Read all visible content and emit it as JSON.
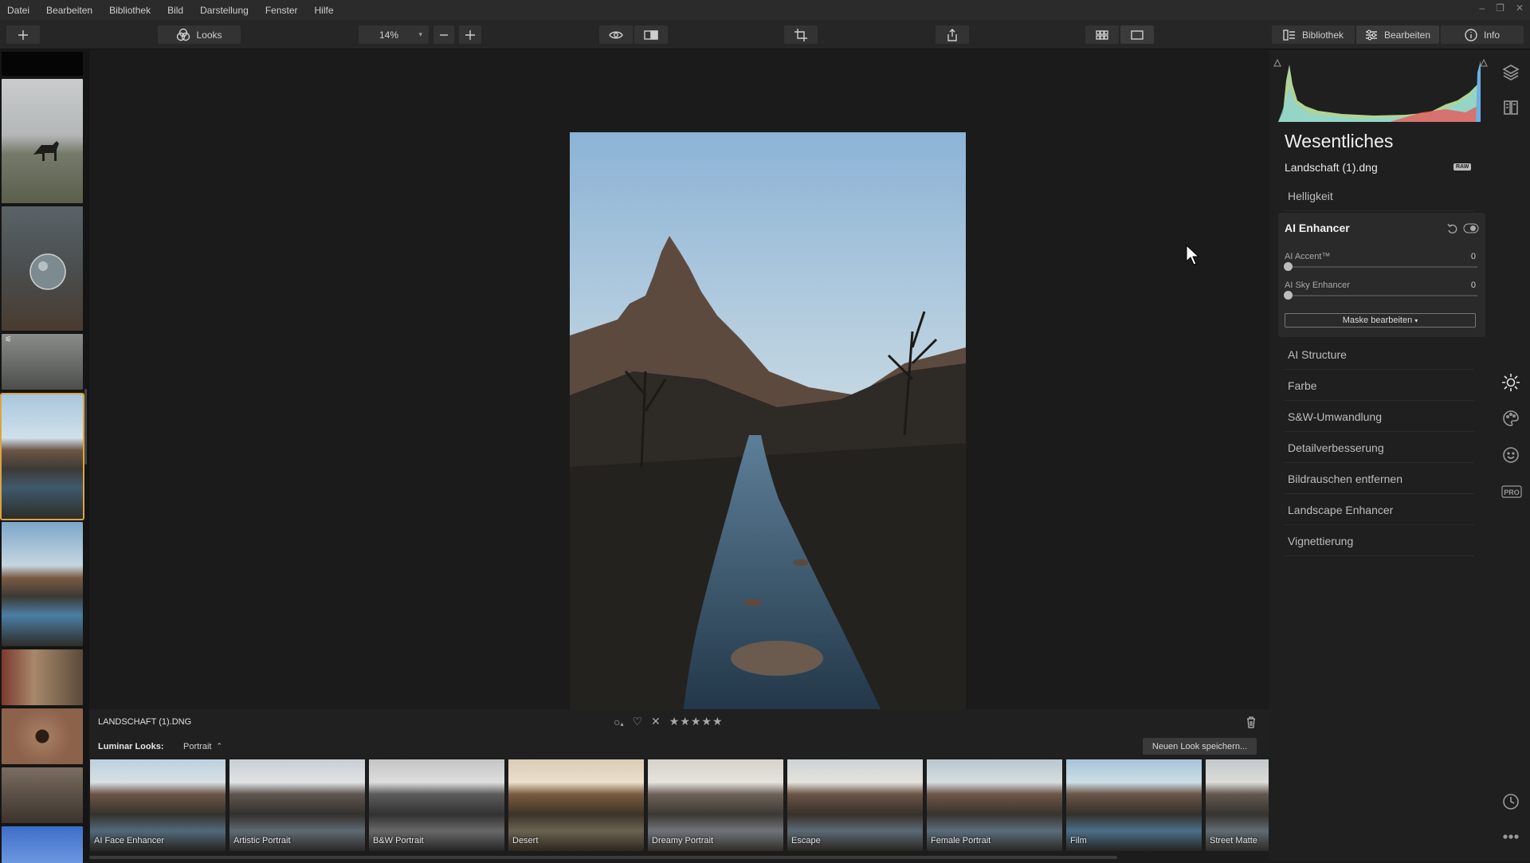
{
  "menu": [
    "Datei",
    "Bearbeiten",
    "Bibliothek",
    "Bild",
    "Darstellung",
    "Fenster",
    "Hilfe"
  ],
  "toolbar": {
    "looks_label": "Looks",
    "zoom_value": "14%",
    "nav_bibliothek": "Bibliothek",
    "nav_bearbeiten": "Bearbeiten",
    "nav_info": "Info"
  },
  "panel": {
    "title": "Wesentliches",
    "filename": "Landschaft (1).dng",
    "raw_badge": "RAW",
    "sections_top": [
      "Helligkeit"
    ],
    "ai_enhancer": {
      "title": "AI Enhancer",
      "sliders": [
        {
          "label": "AI Accent™",
          "value": "0"
        },
        {
          "label": "AI Sky Enhancer",
          "value": "0"
        }
      ],
      "mask_button": "Maske bearbeiten"
    },
    "sections": [
      "AI Structure",
      "Farbe",
      "S&W-Umwandlung",
      "Detailverbesserung",
      "Bildrauschen entfernen",
      "Landscape Enhancer",
      "Vignettierung"
    ]
  },
  "infobar": {
    "filename": "LANDSCHAFT (1).DNG"
  },
  "looksbar": {
    "label": "Luminar Looks:",
    "category": "Portrait",
    "save_button": "Neuen Look speichern..."
  },
  "looks": [
    "AI Face Enhancer",
    "Artistic Portrait",
    "B&W Portrait",
    "Desert",
    "Dreamy Portrait",
    "Escape",
    "Female Portrait",
    "Film",
    "Street Matte"
  ],
  "icons": {
    "add": "plus-icon",
    "looks": "looks-circles-icon",
    "preview": "eye-icon",
    "compare": "compare-icon",
    "crop": "crop-icon",
    "export": "share-icon",
    "grid": "grid-icon",
    "single": "single-view-icon"
  }
}
